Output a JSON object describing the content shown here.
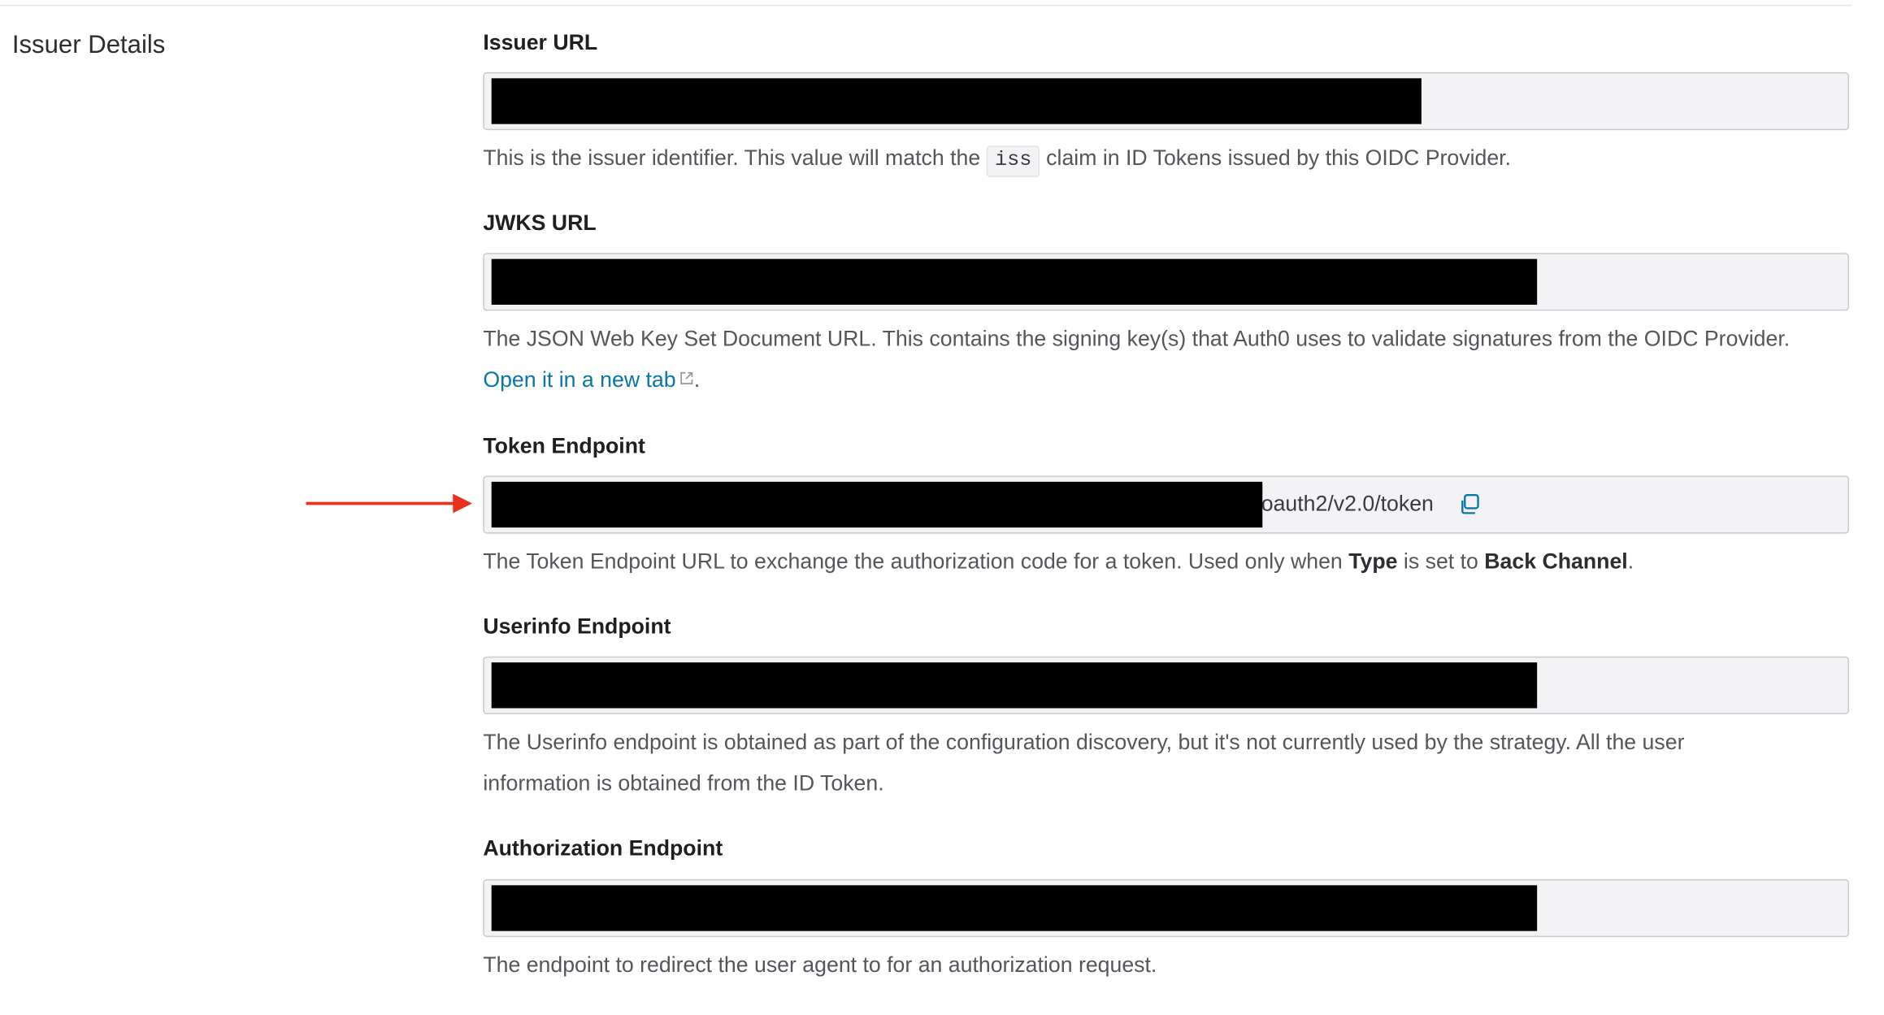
{
  "section": {
    "title": "Issuer Details"
  },
  "fields": {
    "issuer": {
      "label": "Issuer URL",
      "help_before": "This is the issuer identifier. This value will match the",
      "help_code": "iss",
      "help_after": "claim in ID Tokens issued by this OIDC Provider."
    },
    "jwks": {
      "label": "JWKS URL",
      "help": "The JSON Web Key Set Document URL. This contains the signing key(s) that Auth0 uses to validate signatures from the OIDC Provider.",
      "link_text": "Open it in a new tab",
      "link_suffix": "."
    },
    "token": {
      "label": "Token Endpoint",
      "visible_value": "/oauth2/v2.0/token",
      "help_before": "The Token Endpoint URL to exchange the authorization code for a token. Used only when",
      "help_bold_1": "Type",
      "help_middle": "is set to",
      "help_bold_2": "Back Channel",
      "help_after": "."
    },
    "userinfo": {
      "label": "Userinfo Endpoint",
      "help": "The Userinfo endpoint is obtained as part of the configuration discovery, but it's not currently used by the strategy. All the user information is obtained from the ID Token."
    },
    "authorization": {
      "label": "Authorization Endpoint",
      "help": "The endpoint to redirect the user agent to for an authorization request."
    }
  },
  "icons": {
    "copy": "copy-icon",
    "external_link": "external-link-icon",
    "annotation_arrow": "arrow-right-icon"
  },
  "colors": {
    "link": "#0a76a8",
    "annotation_arrow": "#e8321e",
    "field_background": "#f3f3f5",
    "redaction": "#000000"
  }
}
